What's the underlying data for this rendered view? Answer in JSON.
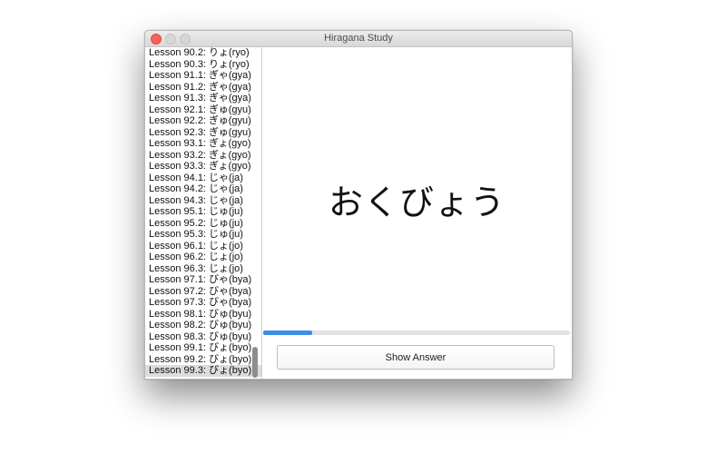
{
  "window": {
    "title": "Hiragana Study"
  },
  "lessons": [
    "Lesson 90.2: りょ(ryo)",
    "Lesson 90.3: りょ(ryo)",
    "Lesson 91.1: ぎゃ(gya)",
    "Lesson 91.2: ぎゃ(gya)",
    "Lesson 91.3: ぎゃ(gya)",
    "Lesson 92.1: ぎゅ(gyu)",
    "Lesson 92.2: ぎゅ(gyu)",
    "Lesson 92.3: ぎゅ(gyu)",
    "Lesson 93.1: ぎょ(gyo)",
    "Lesson 93.2: ぎょ(gyo)",
    "Lesson 93.3: ぎょ(gyo)",
    "Lesson 94.1: じゃ(ja)",
    "Lesson 94.2: じゃ(ja)",
    "Lesson 94.3: じゃ(ja)",
    "Lesson 95.1: じゅ(ju)",
    "Lesson 95.2: じゅ(ju)",
    "Lesson 95.3: じゅ(ju)",
    "Lesson 96.1: じょ(jo)",
    "Lesson 96.2: じょ(jo)",
    "Lesson 96.3: じょ(jo)",
    "Lesson 97.1: びゃ(bya)",
    "Lesson 97.2: びゃ(bya)",
    "Lesson 97.3: びゃ(bya)",
    "Lesson 98.1: びゅ(byu)",
    "Lesson 98.2: びゅ(byu)",
    "Lesson 98.3: びゅ(byu)",
    "Lesson 99.1: びょ(byo)",
    "Lesson 99.2: びょ(byo)",
    "Lesson 99.3: びょ(byo)"
  ],
  "selected_lesson_index": 28,
  "study": {
    "word": "おくびょう",
    "progress_fraction": 0.16,
    "show_answer_label": "Show Answer"
  },
  "colors": {
    "close_button": "#fc605c",
    "progress_fill": "#3d8ee8",
    "selection": "#dcdcdc"
  }
}
